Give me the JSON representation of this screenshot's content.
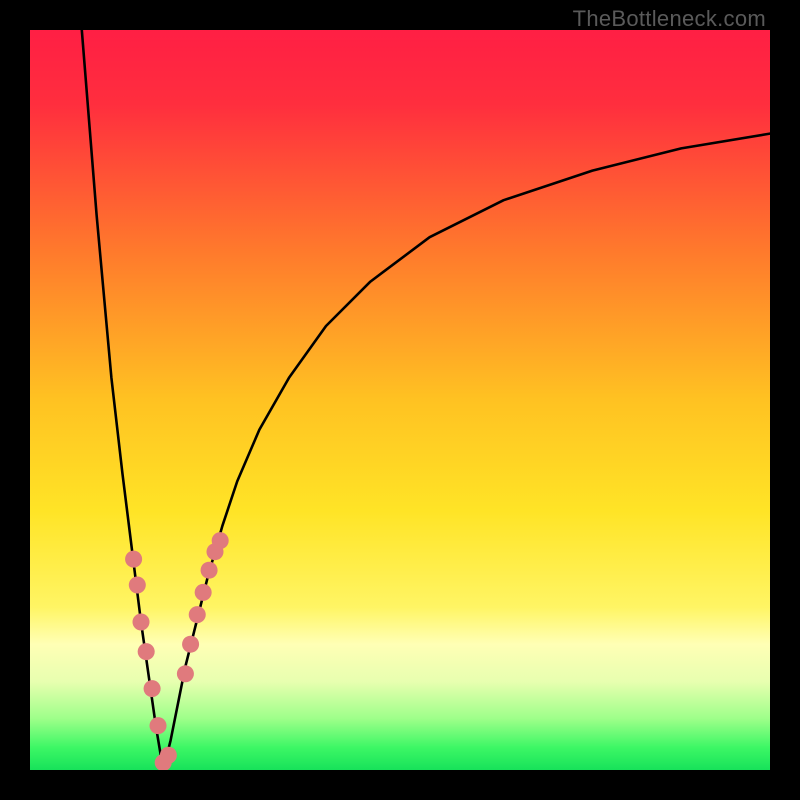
{
  "watermark": "TheBottleneck.com",
  "colors": {
    "frame": "#000000",
    "gradient_stops": [
      {
        "offset": 0.0,
        "color": "#ff1f44"
      },
      {
        "offset": 0.1,
        "color": "#ff2e3e"
      },
      {
        "offset": 0.3,
        "color": "#ff7a2c"
      },
      {
        "offset": 0.5,
        "color": "#ffc222"
      },
      {
        "offset": 0.65,
        "color": "#ffe426"
      },
      {
        "offset": 0.78,
        "color": "#fff564"
      },
      {
        "offset": 0.83,
        "color": "#ffffb5"
      },
      {
        "offset": 0.88,
        "color": "#e8ffb0"
      },
      {
        "offset": 0.93,
        "color": "#9fff8a"
      },
      {
        "offset": 0.97,
        "color": "#3cf765"
      },
      {
        "offset": 1.0,
        "color": "#17e25a"
      }
    ],
    "curve": "#000000",
    "marker": "#e07a7d"
  },
  "chart_data": {
    "type": "line",
    "title": "",
    "xlabel": "",
    "ylabel": "",
    "xlim": [
      0,
      100
    ],
    "ylim": [
      0,
      100
    ],
    "notes": "Bottleneck-style valley curve. Minimum (y=0) near x≈18. Left branch rises steeply to y=100 at x≈7; right branch rises with decreasing slope reaching y≈86 at x=100. Salmon markers cluster near the valley on both branches.",
    "series": [
      {
        "name": "curve",
        "x": [
          7,
          9,
          11,
          12.5,
          14,
          15,
          16,
          17,
          18,
          19,
          20,
          21,
          22.5,
          24,
          26,
          28,
          31,
          35,
          40,
          46,
          54,
          64,
          76,
          88,
          100
        ],
        "y": [
          100,
          75,
          53,
          40,
          28,
          20,
          13,
          6,
          0,
          4,
          9,
          14,
          20,
          26,
          33,
          39,
          46,
          53,
          60,
          66,
          72,
          77,
          81,
          84,
          86
        ]
      },
      {
        "name": "markers",
        "x": [
          14,
          14.5,
          15,
          15.7,
          16.5,
          17.3,
          18,
          18.7,
          21,
          21.7,
          22.6,
          23.4,
          24.2,
          25,
          25.7
        ],
        "y": [
          28.5,
          25,
          20,
          16,
          11,
          6,
          1,
          2,
          13,
          17,
          21,
          24,
          27,
          29.5,
          31
        ]
      }
    ]
  }
}
